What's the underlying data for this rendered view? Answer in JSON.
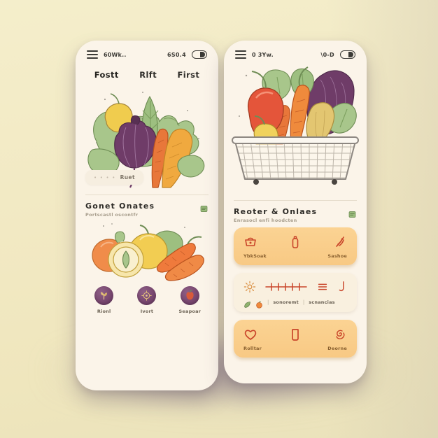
{
  "background": {
    "color": "#f2e9c3",
    "shadow_color": "#7a6882"
  },
  "theme": {
    "phone_bg": "#fbf4e9",
    "accent_orange": "#f8c984",
    "accent_red": "#d4512a",
    "accent_purple": "#78476f",
    "text_dark": "#2f2d29",
    "text_muted": "#a79d8c"
  },
  "left_phone": {
    "status": {
      "menu_icon": "hamburger-icon",
      "left_text": "60Wk..",
      "right_text": "6S0.4",
      "battery_icon": "battery-icon"
    },
    "tabs": [
      {
        "label": "Fostt",
        "active": true
      },
      {
        "label": "Rlft",
        "active": false
      },
      {
        "label": "First",
        "active": false
      }
    ],
    "hero": {
      "name": "vegetable-illustration",
      "chip": {
        "dots": "• • • •",
        "label": "Ruet"
      }
    },
    "section": {
      "title": "Gonet  Onates",
      "subtitle": "Portscastl oscontfr",
      "badge_icon": "leaf-badge-icon"
    },
    "secondary_illustration": "fruit-carrot-illustration",
    "quick_actions": [
      {
        "label": "Rionl",
        "icon": "sprout-icon"
      },
      {
        "label": "Ivort",
        "icon": "seed-icon"
      },
      {
        "label": "Seapoar",
        "icon": "apple-icon"
      }
    ]
  },
  "right_phone": {
    "status": {
      "menu_icon": "hamburger-icon",
      "left_text": "0 3Yw.",
      "right_text": "\\0-D",
      "battery_icon": "battery-icon"
    },
    "basket_illustration": "shopping-basket-illustration",
    "section": {
      "title": "Reoter & Onlaes",
      "subtitle": "Enrasocl enfi hoodcten",
      "badge_icon": "leaf-badge-icon"
    },
    "cards": [
      {
        "style": "orange",
        "icons": [
          "basket-icon",
          "bottle-icon",
          "wheat-icon"
        ],
        "labels": [
          "YbkSoak",
          "",
          "Sashoe"
        ]
      },
      {
        "style": "cream",
        "icons": [
          "sun-icon",
          "ruler-icon",
          "list-icon",
          "hook-icon"
        ],
        "meta_icons": [
          "leaf-mini-icon",
          "orange-mini-icon"
        ],
        "meta": [
          "sonoremt",
          "scnancias"
        ],
        "separator": "|"
      },
      {
        "style": "orange",
        "icons": [
          "heart-icon",
          "cup-icon",
          "swirl-icon"
        ],
        "labels": [
          "Rolltar",
          "",
          "Deorne"
        ]
      }
    ]
  }
}
